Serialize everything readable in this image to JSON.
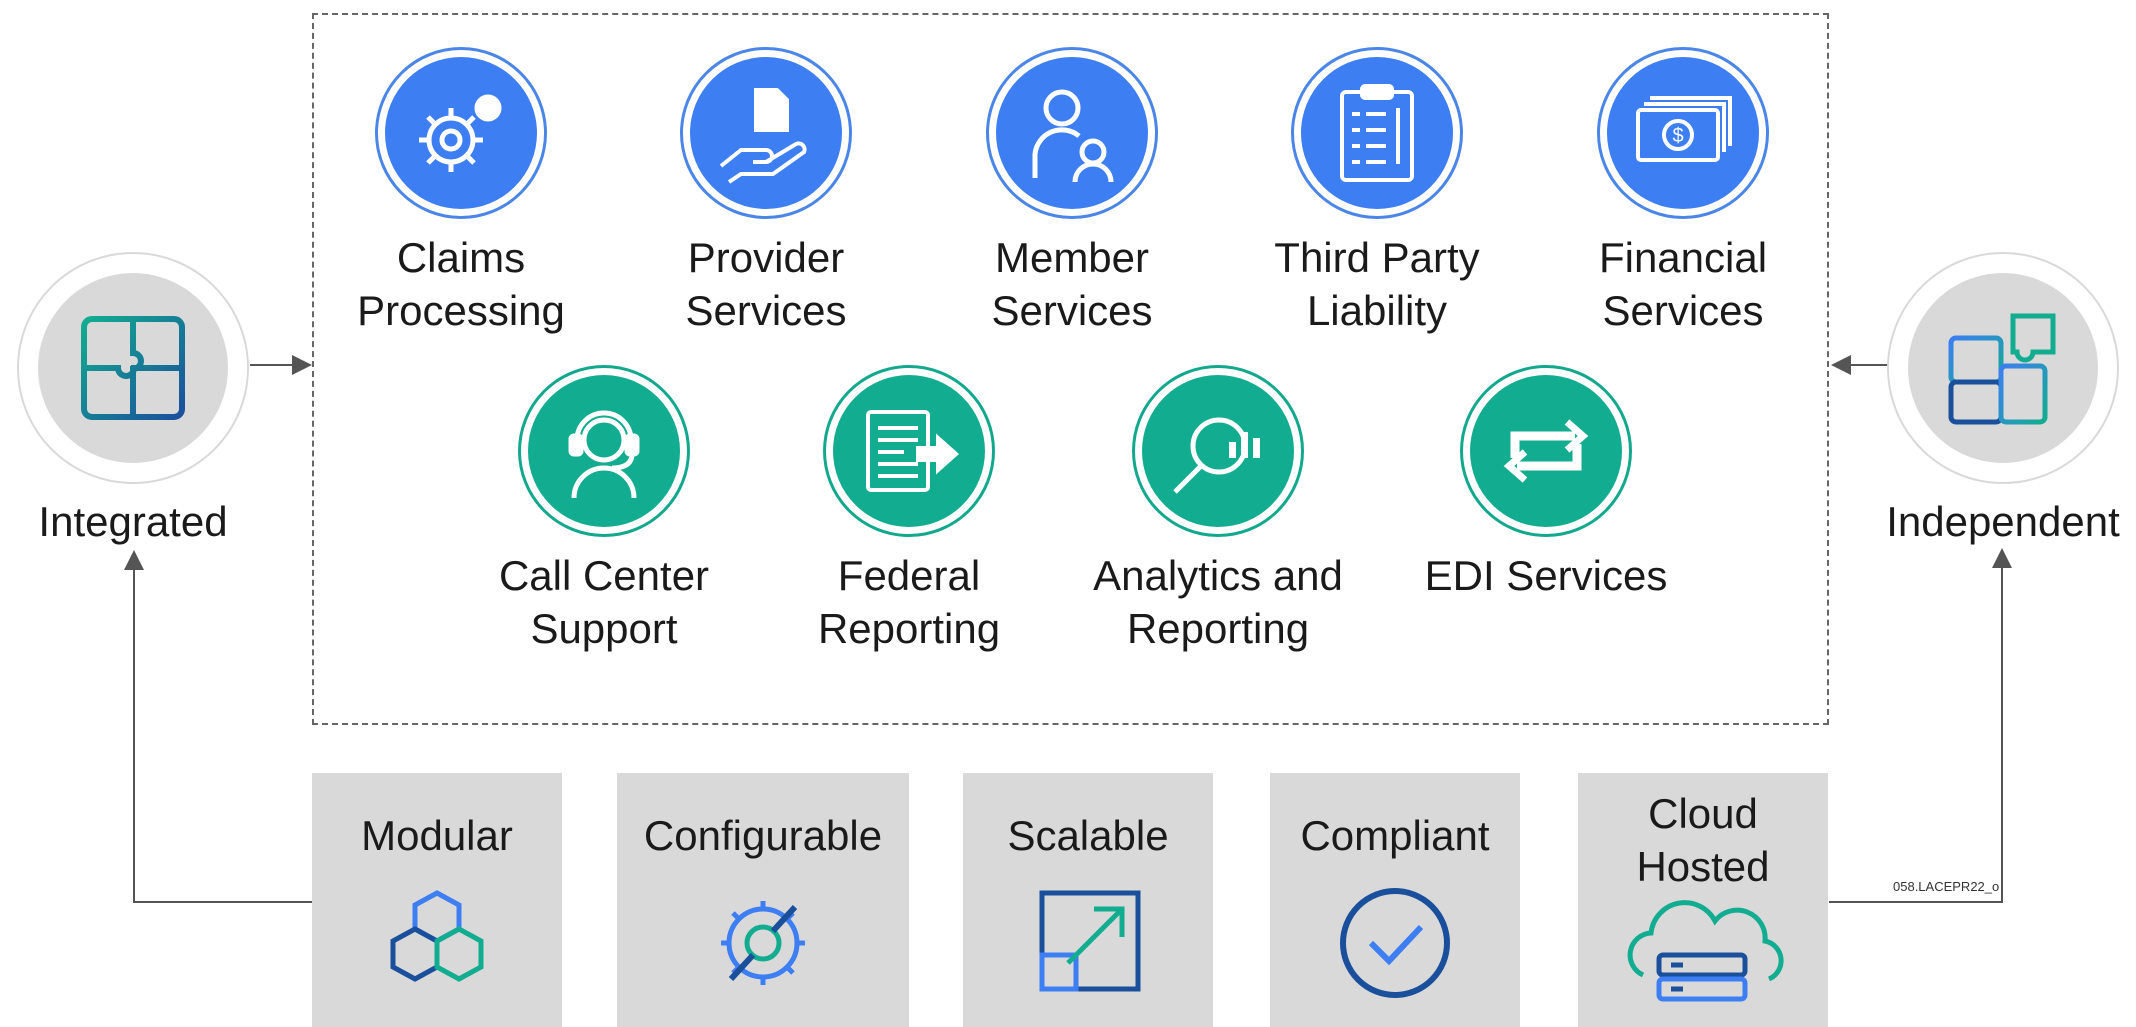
{
  "sides": {
    "left": {
      "label": "Integrated",
      "icon": "puzzle-icon"
    },
    "right": {
      "label": "Independent",
      "icon": "puzzle-separated-icon"
    }
  },
  "services_row1": [
    {
      "label": "Claims\nProcessing",
      "icon": "gears-icon"
    },
    {
      "label": "Provider\nServices",
      "icon": "hand-document-icon"
    },
    {
      "label": "Member\nServices",
      "icon": "people-icon"
    },
    {
      "label": "Third Party\nLiability",
      "icon": "clipboard-icon"
    },
    {
      "label": "Financial\nServices",
      "icon": "money-icon"
    }
  ],
  "services_row2": [
    {
      "label": "Call Center\nSupport",
      "icon": "headset-icon"
    },
    {
      "label": "Federal\nReporting",
      "icon": "report-export-icon"
    },
    {
      "label": "Analytics and\nReporting",
      "icon": "magnifier-chart-icon"
    },
    {
      "label": "EDI Services",
      "icon": "exchange-arrows-icon"
    }
  ],
  "features": [
    {
      "label": "Modular",
      "icon": "cubes-icon"
    },
    {
      "label": "Configurable",
      "icon": "gear-wrench-icon"
    },
    {
      "label": "Scalable",
      "icon": "expand-icon"
    },
    {
      "label": "Compliant",
      "icon": "check-circle-icon"
    },
    {
      "label": "Cloud\nHosted",
      "icon": "cloud-server-icon"
    }
  ],
  "footer_code": "058.LACEPR22_o",
  "colors": {
    "blue": "#3d7ef2",
    "teal": "#12ad90",
    "panel": "#d9d9d9"
  }
}
